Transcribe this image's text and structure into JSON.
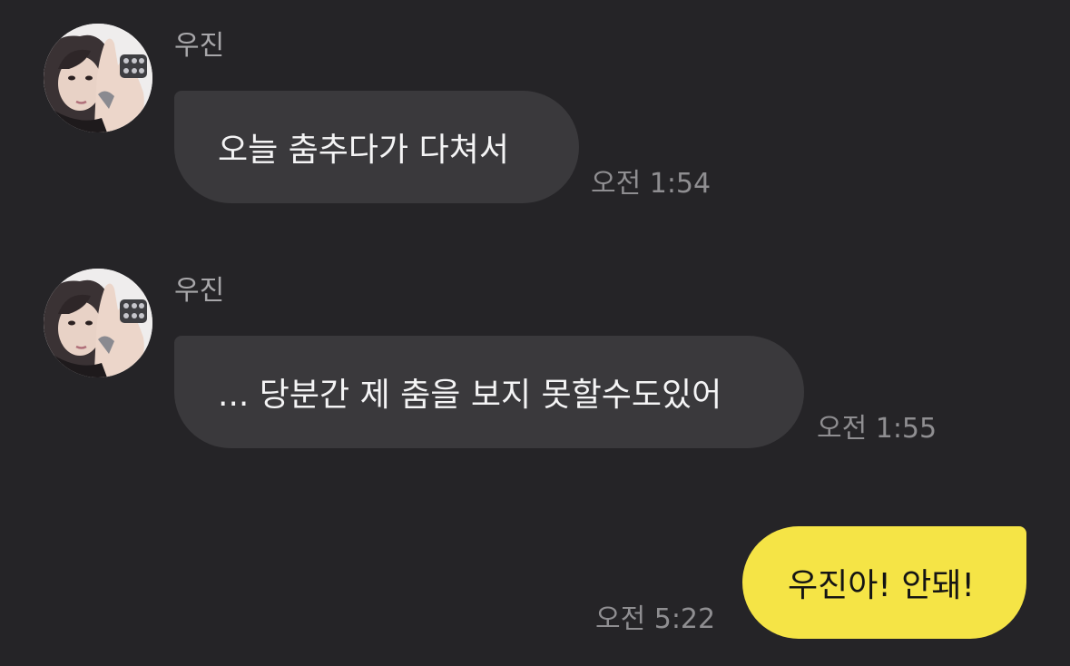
{
  "colors": {
    "background": "#252427",
    "incoming_bubble": "#3a393c",
    "outgoing_bubble": "#f5e446",
    "sender_name": "#a8a7aa",
    "timestamp": "#8f8e91"
  },
  "messages": [
    {
      "direction": "incoming",
      "sender": "우진",
      "avatar": "profile-photo",
      "text": "오늘 춤추다가 다쳐서",
      "time": "오전 1:54"
    },
    {
      "direction": "incoming",
      "sender": "우진",
      "avatar": "profile-photo",
      "text": "... 당분간 제 춤을 보지 못할수도있어",
      "time": "오전 1:55"
    },
    {
      "direction": "outgoing",
      "text": "우진아! 안돼!",
      "time": "오전 5:22"
    }
  ]
}
